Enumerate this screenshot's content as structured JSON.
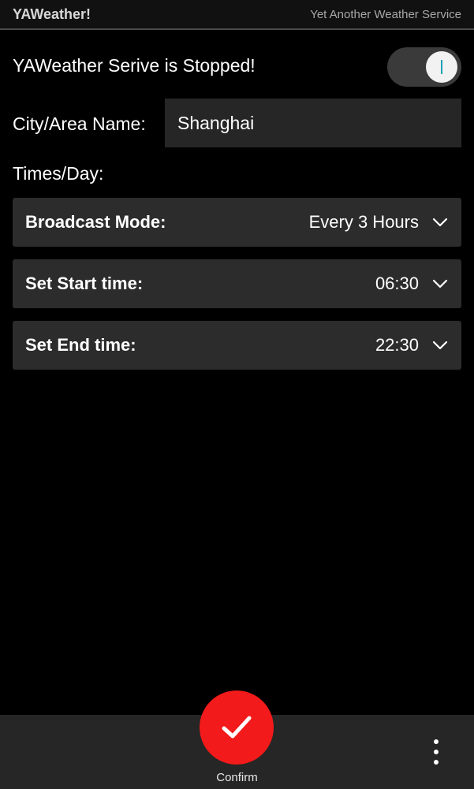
{
  "titlebar": {
    "title": "YAWeather!",
    "subtitle": "Yet Another Weather Service"
  },
  "service": {
    "status_text": "YAWeather Serive is Stopped!",
    "toggle_state": "off"
  },
  "city": {
    "label": "City/Area Name:",
    "value": "Shanghai"
  },
  "times_label": "Times/Day:",
  "dropdowns": {
    "broadcast_mode": {
      "label": "Broadcast Mode:",
      "value": "Every 3 Hours"
    },
    "start_time": {
      "label": "Set Start time:",
      "value": "06:30"
    },
    "end_time": {
      "label": "Set End time:",
      "value": "22:30"
    }
  },
  "actionbar": {
    "confirm_label": "Confirm",
    "confirm_icon": "checkmark-icon",
    "overflow_icon": "more-vertical-icon"
  },
  "colors": {
    "background": "#000000",
    "control_bg": "#2c2c2c",
    "confirm_red": "#f21a1a",
    "toggle_accent": "#1aa3b8"
  }
}
